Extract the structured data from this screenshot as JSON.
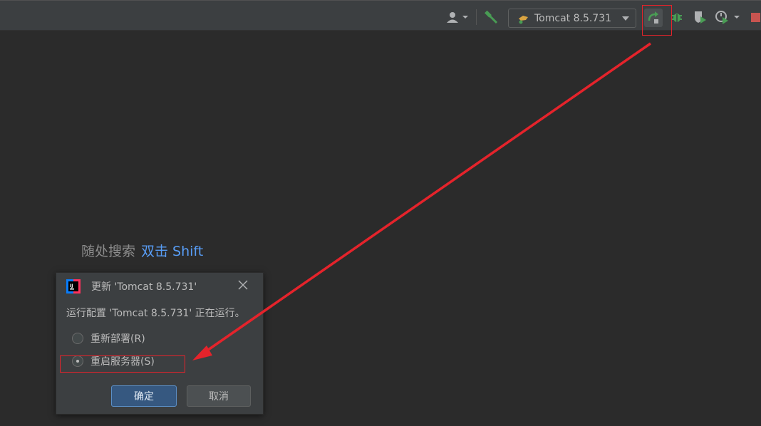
{
  "toolbar": {
    "run_config_label": "Tomcat 8.5.731",
    "icons": [
      "user-icon",
      "build-hammer-icon",
      "tomcat-icon",
      "update-running-app-icon",
      "debug-icon",
      "coverage-icon",
      "profile-icon",
      "stop-icon"
    ]
  },
  "hint": {
    "text": "随处搜索",
    "shortcut": "双击 Shift"
  },
  "dialog": {
    "title": "更新 'Tomcat 8.5.731'",
    "message": "运行配置 'Tomcat 8.5.731' 正在运行。",
    "options": [
      {
        "label": "重新部署(R)",
        "selected": false
      },
      {
        "label": "重启服务器(S)",
        "selected": true
      }
    ],
    "ok_label": "确定",
    "cancel_label": "取消"
  },
  "colors": {
    "annotation": "#e5232b",
    "accent": "#589df6",
    "run_green": "#499c54",
    "stop_red": "#c75450"
  }
}
